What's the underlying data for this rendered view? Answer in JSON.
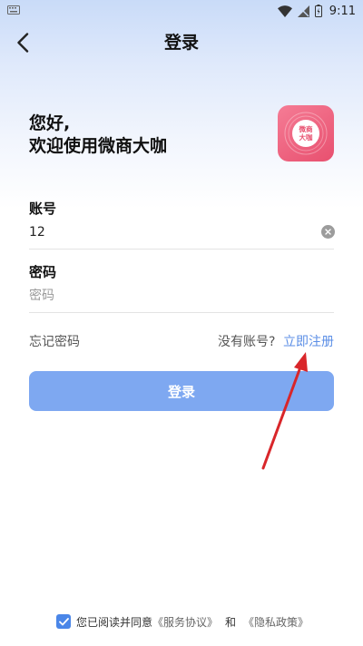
{
  "status_bar": {
    "time": "9:11",
    "icons": [
      "keyboard-icon",
      "wifi-icon",
      "signal-icon",
      "battery-icon"
    ]
  },
  "nav": {
    "title": "登录",
    "back_icon": "back-chevron-icon"
  },
  "greeting": {
    "line1": "您好,",
    "line2": "欢迎使用微商大咖"
  },
  "logo": {
    "text_line1": "微商",
    "text_line2": "大咖",
    "color": "#ee6a86"
  },
  "account": {
    "label": "账号",
    "value": "12",
    "clear_icon": "clear-icon"
  },
  "password": {
    "label": "密码",
    "placeholder": "密码"
  },
  "links": {
    "forgot": "忘记密码",
    "no_account": "没有账号?",
    "register": "立即注册",
    "link_color": "#5b8ee6"
  },
  "login_button": {
    "label": "登录",
    "color": "#7ea8f1"
  },
  "agreement": {
    "checked": true,
    "text": "您已阅读并同意",
    "service": "《服务协议》",
    "and": "和",
    "privacy": "《隐私政策》"
  },
  "annotation": {
    "arrow_color": "#d9262a"
  }
}
